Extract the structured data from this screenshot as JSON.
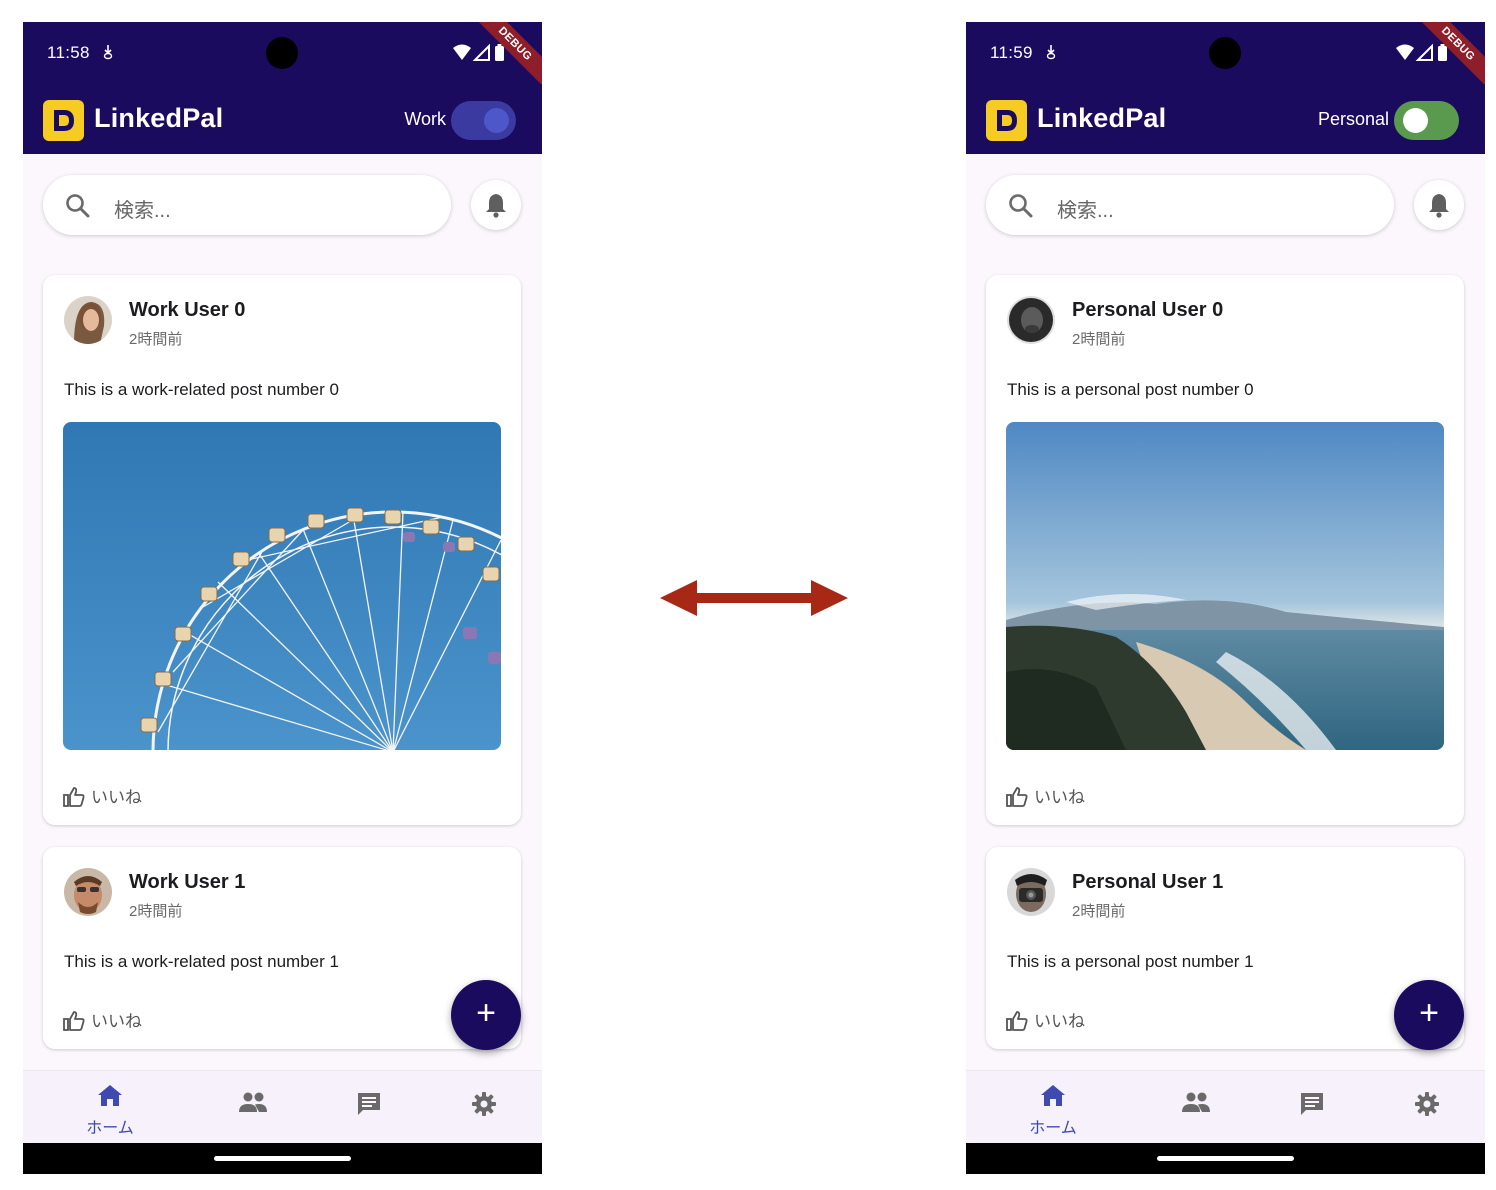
{
  "screens": [
    {
      "status_time": "11:58",
      "debug_label": "DEBUG",
      "app_title": "LinkedPal",
      "mode_label": "Work",
      "mode_toggle_state": "on",
      "search_placeholder": "検索...",
      "posts": [
        {
          "user": "Work User 0",
          "time": "2時間前",
          "text": "This is a work-related post number 0",
          "like_label": "いいね",
          "image": "ferris-wheel"
        },
        {
          "user": "Work User 1",
          "time": "2時間前",
          "text": "This is a work-related post number 1",
          "like_label": "いいね"
        }
      ],
      "fab_label": "+",
      "nav": {
        "home_label": "ホーム"
      }
    },
    {
      "status_time": "11:59",
      "debug_label": "DEBUG",
      "app_title": "LinkedPal",
      "mode_label": "Personal",
      "mode_toggle_state": "off",
      "search_placeholder": "検索...",
      "posts": [
        {
          "user": "Personal User 0",
          "time": "2時間前",
          "text": "This is a personal post number 0",
          "like_label": "いいね",
          "image": "coastline"
        },
        {
          "user": "Personal User 1",
          "time": "2時間前",
          "text": "This is a personal post number 1",
          "like_label": "いいね"
        }
      ],
      "fab_label": "+",
      "nav": {
        "home_label": "ホーム"
      }
    }
  ],
  "colors": {
    "app_bar": "#1b0b5e",
    "logo": "#f7cc22",
    "toggle_work": "#3a3aa0",
    "toggle_personal": "#5a9a4e",
    "arrow": "#a82816",
    "nav_active": "#3f4ab0"
  },
  "icons": [
    "search-icon",
    "bell-icon",
    "thumb-up-icon",
    "home-icon",
    "people-icon",
    "chat-icon",
    "gear-icon",
    "plus-icon",
    "double-arrow-icon"
  ]
}
